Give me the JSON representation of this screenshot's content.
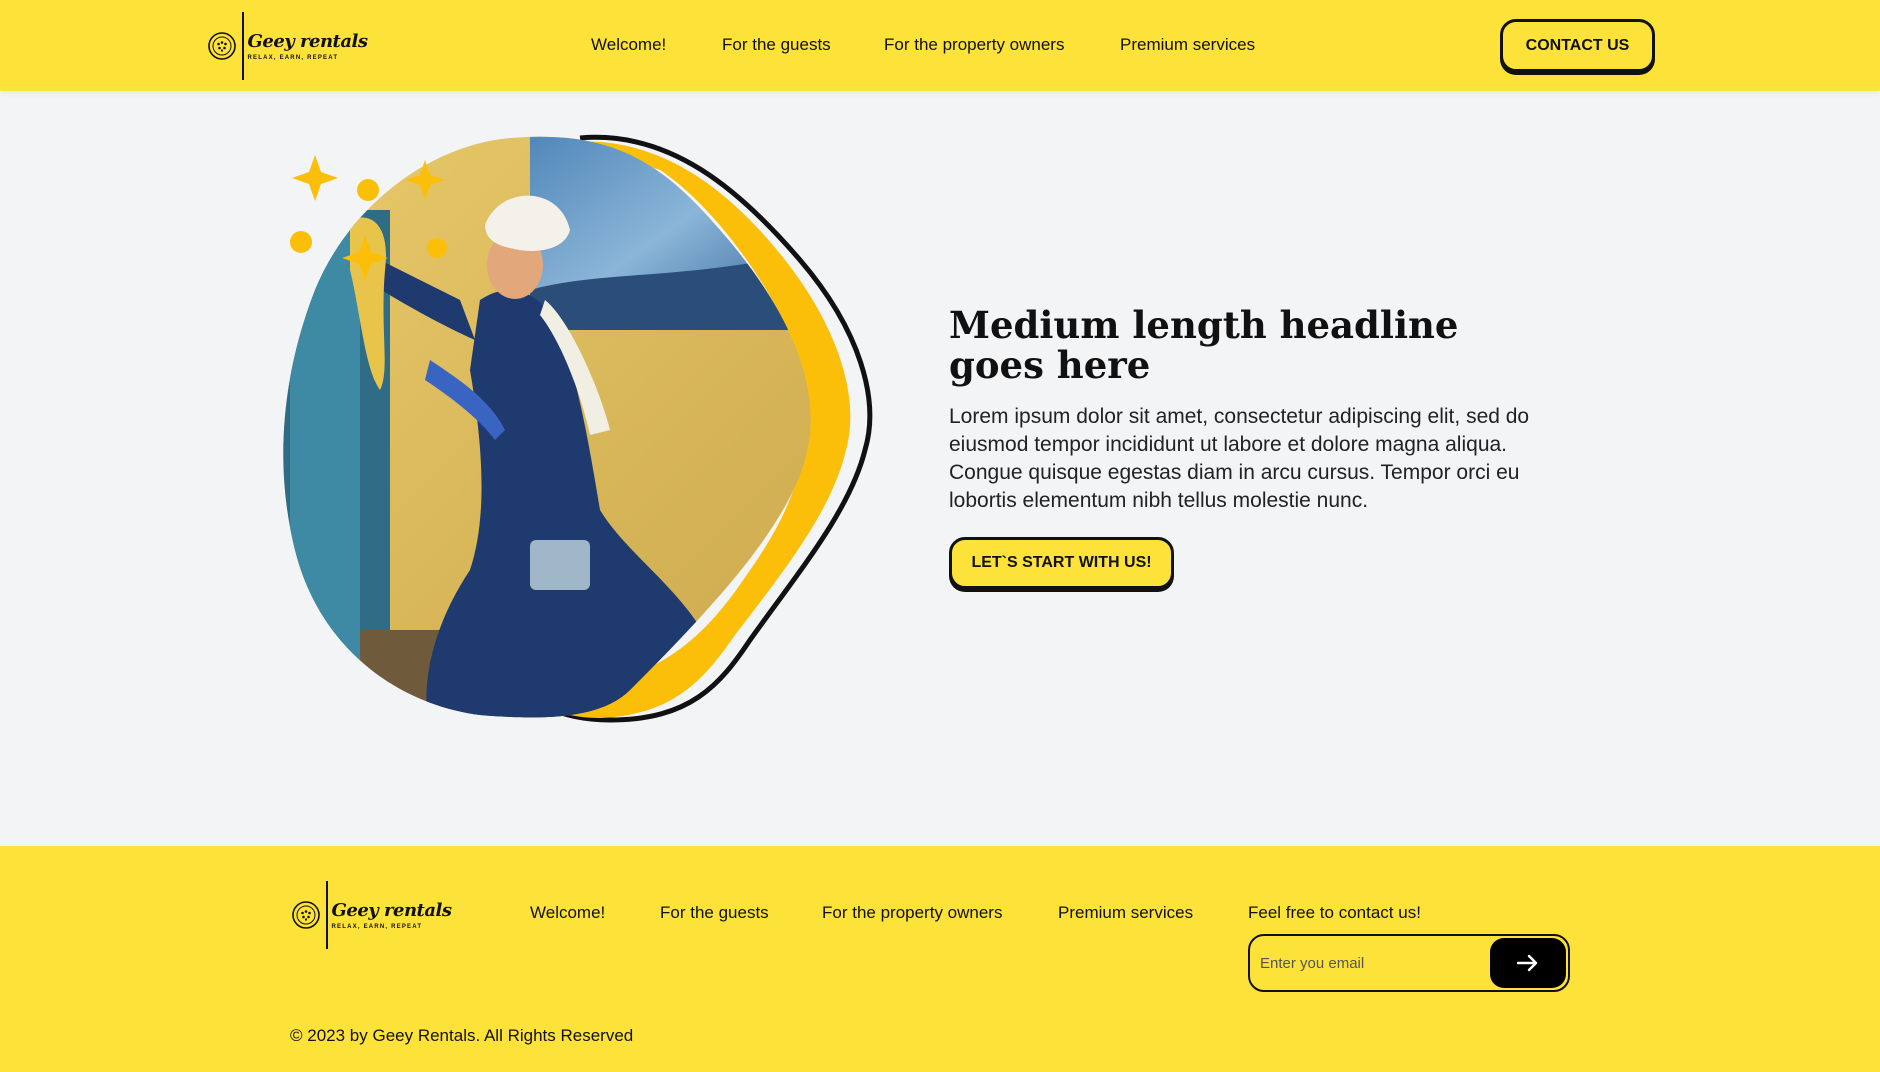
{
  "brand": {
    "name": "Geey rentals",
    "tagline": "RELAX, EARN, REPEAT"
  },
  "header": {
    "nav": [
      "Welcome!",
      "For the guests",
      "For the property owners",
      "Premium services"
    ],
    "contact_label": "CONTACT US"
  },
  "hero": {
    "headline": "Medium length headline goes here",
    "body": "Lorem ipsum dolor sit amet, consectetur adipiscing elit, sed do eiusmod tempor incididunt ut labore et dolore magna aliqua. Congue quisque egestas diam in arcu cursus. Tempor orci eu lobortis elementum nibh tellus molestie nunc.",
    "cta_label": "LET`S START WITH US!"
  },
  "footer": {
    "nav": [
      "Welcome!",
      "For the guests",
      "For the property owners",
      "Premium services"
    ],
    "contact_label": "Feel free to contact us!",
    "email_placeholder": "Enter you email",
    "copyright": "© 2023 by Geey Rentals. All Rights Reserved"
  },
  "colors": {
    "brand_yellow": "#fde23a",
    "accent_gold": "#fbbf0a",
    "ink": "#111111",
    "page_bg": "#f3f4f6"
  },
  "icons": {
    "logo": "lighthouse-logo-icon",
    "submit": "arrow-right-icon",
    "decor": [
      "sparkle-icon",
      "dot-icon"
    ]
  }
}
